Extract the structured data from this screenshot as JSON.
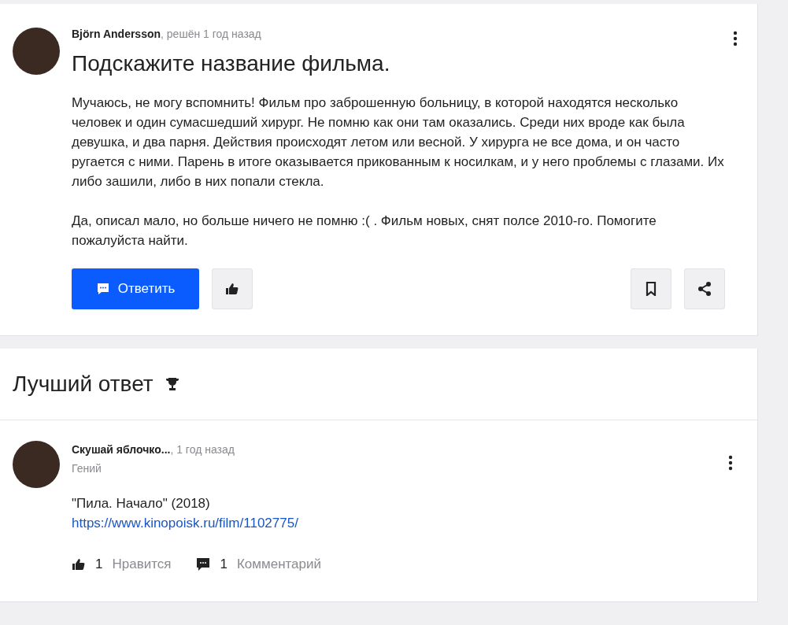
{
  "question": {
    "author": "Björn Andersson",
    "meta": ", решён 1 год назад",
    "title": "Подскажите название фильма.",
    "paragraphs": [
      "Мучаюсь, не могу вспомнить! Фильм про заброшенную больницу, в которой находятся несколько человек и один сумасшедший хирург. Не помню как они там оказались. Среди них вроде как была девушка, и два парня. Действия происходят летом или весной. У хирурга не все дома, и он часто ругается с ними. Парень в итоге оказывается прикованным к носилкам, и у него проблемы с глазами. Их либо зашили, либо в них попали стекла.",
      "Да, описал мало, но больше ничего не помню :( . Фильм новых, снят полсе 2010-го. Помогите пожалуйста найти."
    ],
    "reply_button": "Ответить"
  },
  "best_answer": {
    "heading": "Лучший ответ",
    "author": "Скушай яблочко...",
    "meta": ", 1 год назад",
    "rank": "Гений",
    "lines": [
      {
        "kind": "text",
        "text": "\"Пила. Начало\" (2018)"
      },
      {
        "kind": "link",
        "text": "https://www.kinopoisk.ru/film/1102775/"
      }
    ],
    "likes": {
      "count": "1",
      "label": "Нравится"
    },
    "comments": {
      "count": "1",
      "label": "Комментарий"
    }
  }
}
